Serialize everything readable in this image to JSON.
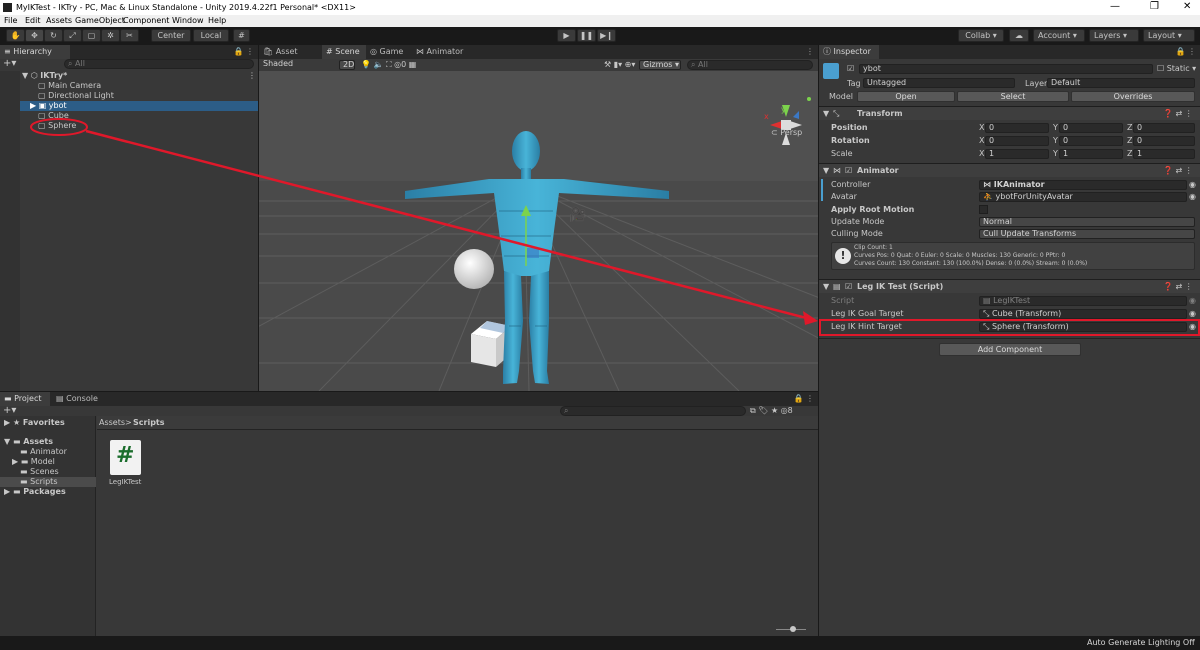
{
  "window": {
    "title": "MyIKTest - IKTry - PC, Mac & Linux Standalone - Unity 2019.4.22f1 Personal* <DX11>",
    "controls": [
      "—",
      "❐",
      "✕"
    ]
  },
  "menu": [
    "File",
    "Edit",
    "Assets",
    "GameObject",
    "Component",
    "Window",
    "Help"
  ],
  "toolbar": {
    "pivot_center": "Center",
    "pivot_local": "Local",
    "collab": "Collab ▾",
    "account": "Account",
    "layers": "Layers",
    "layout": "Layout"
  },
  "hierarchy": {
    "tab": "Hierarchy",
    "search_placeholder": "All",
    "scene": "IKTry*",
    "items": [
      "Main Camera",
      "Directional Light",
      "ybot",
      "Cube",
      "Sphere"
    ]
  },
  "scene_view": {
    "tabs": [
      "Asset Store",
      "Scene",
      "Game",
      "Animator"
    ],
    "shading": "Shaded",
    "mode2d": "2D",
    "layers_count": "0",
    "gizmos": "Gizmos",
    "search_placeholder": "All",
    "persp": "Persp",
    "axis_x": "x",
    "axis_y": "y"
  },
  "inspector": {
    "tab": "Inspector",
    "object_name": "ybot",
    "static_label": "Static",
    "tag_label": "Tag",
    "tag_value": "Untagged",
    "layer_label": "Layer",
    "layer_value": "Default",
    "model_label": "Model",
    "open_btn": "Open",
    "select_btn": "Select",
    "overrides_btn": "Overrides",
    "transform": {
      "title": "Transform",
      "rows": [
        {
          "label": "Position",
          "x": "0",
          "y": "0",
          "z": "0"
        },
        {
          "label": "Rotation",
          "x": "0",
          "y": "0",
          "z": "0"
        },
        {
          "label": "Scale",
          "x": "1",
          "y": "1",
          "z": "1"
        }
      ],
      "axis": [
        "X",
        "Y",
        "Z"
      ]
    },
    "animator": {
      "title": "Animator",
      "controller_label": "Controller",
      "controller_value": "IKAnimator",
      "avatar_label": "Avatar",
      "avatar_value": "ybotForUnityAvatar",
      "root_motion_label": "Apply Root Motion",
      "update_label": "Update Mode",
      "update_value": "Normal",
      "culling_label": "Culling Mode",
      "culling_value": "Cull Update Transforms",
      "info1": "Clip Count: 1",
      "info2": "Curves Pos: 0 Quat: 0 Euler: 0 Scale: 0 Muscles: 130 Generic: 0 PPtr: 0",
      "info3": "Curves Count: 130 Constant: 130 (100.0%) Dense: 0 (0.0%) Stream: 0 (0.0%)"
    },
    "legik": {
      "title": "Leg IK Test (Script)",
      "script_label": "Script",
      "script_value": "LegIKTest",
      "goal_label": "Leg IK Goal Target",
      "goal_value": "Cube (Transform)",
      "hint_label": "Leg IK Hint Target",
      "hint_value": "Sphere (Transform)"
    },
    "add_component": "Add Component"
  },
  "project": {
    "tabs": [
      "Project",
      "Console"
    ],
    "favorites": "Favorites",
    "assets": "Assets",
    "folders": [
      "Animator",
      "Model",
      "Scenes",
      "Scripts"
    ],
    "packages": "Packages",
    "breadcrumb_root": "Assets",
    "breadcrumb_sep": ">",
    "breadcrumb_leaf": "Scripts",
    "file_name": "LegIKTest",
    "file_glyph": "#",
    "hidden_count": "8"
  },
  "status": {
    "text": "Auto Generate Lighting Off"
  },
  "colors": {
    "annotation_red": "#e0182a",
    "selection_blue": "#2c5d87",
    "model_cyan": "#3aa6c8"
  }
}
